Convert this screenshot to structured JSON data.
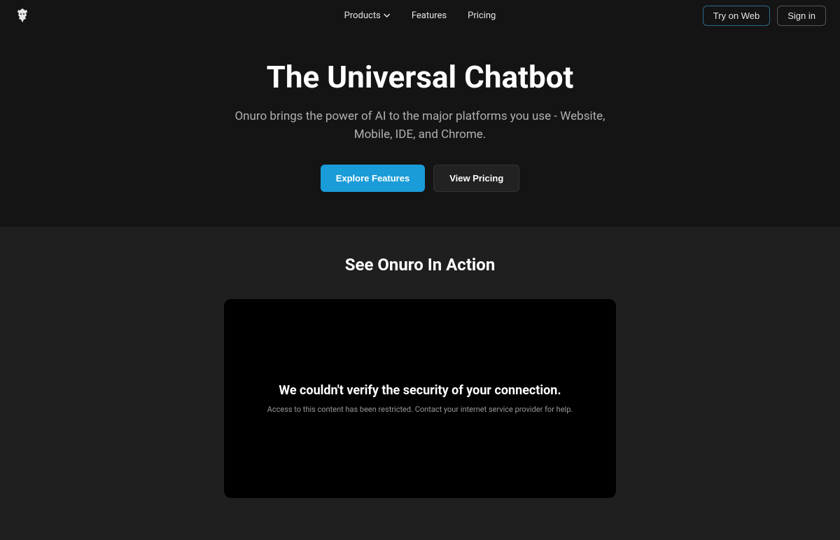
{
  "nav": {
    "products": "Products",
    "features": "Features",
    "pricing": "Pricing"
  },
  "header": {
    "tryOnWeb": "Try on Web",
    "signIn": "Sign in"
  },
  "hero": {
    "title": "The Universal Chatbot",
    "subtitle": "Onuro brings the power of AI to the major platforms you use - Website, Mobile, IDE, and Chrome.",
    "exploreFeatures": "Explore Features",
    "viewPricing": "View Pricing"
  },
  "section": {
    "title": "See Onuro In Action"
  },
  "video": {
    "errorTitle": "We couldn't verify the security of your connection.",
    "errorText": "Access to this content has been restricted. Contact your internet service provider for help."
  }
}
